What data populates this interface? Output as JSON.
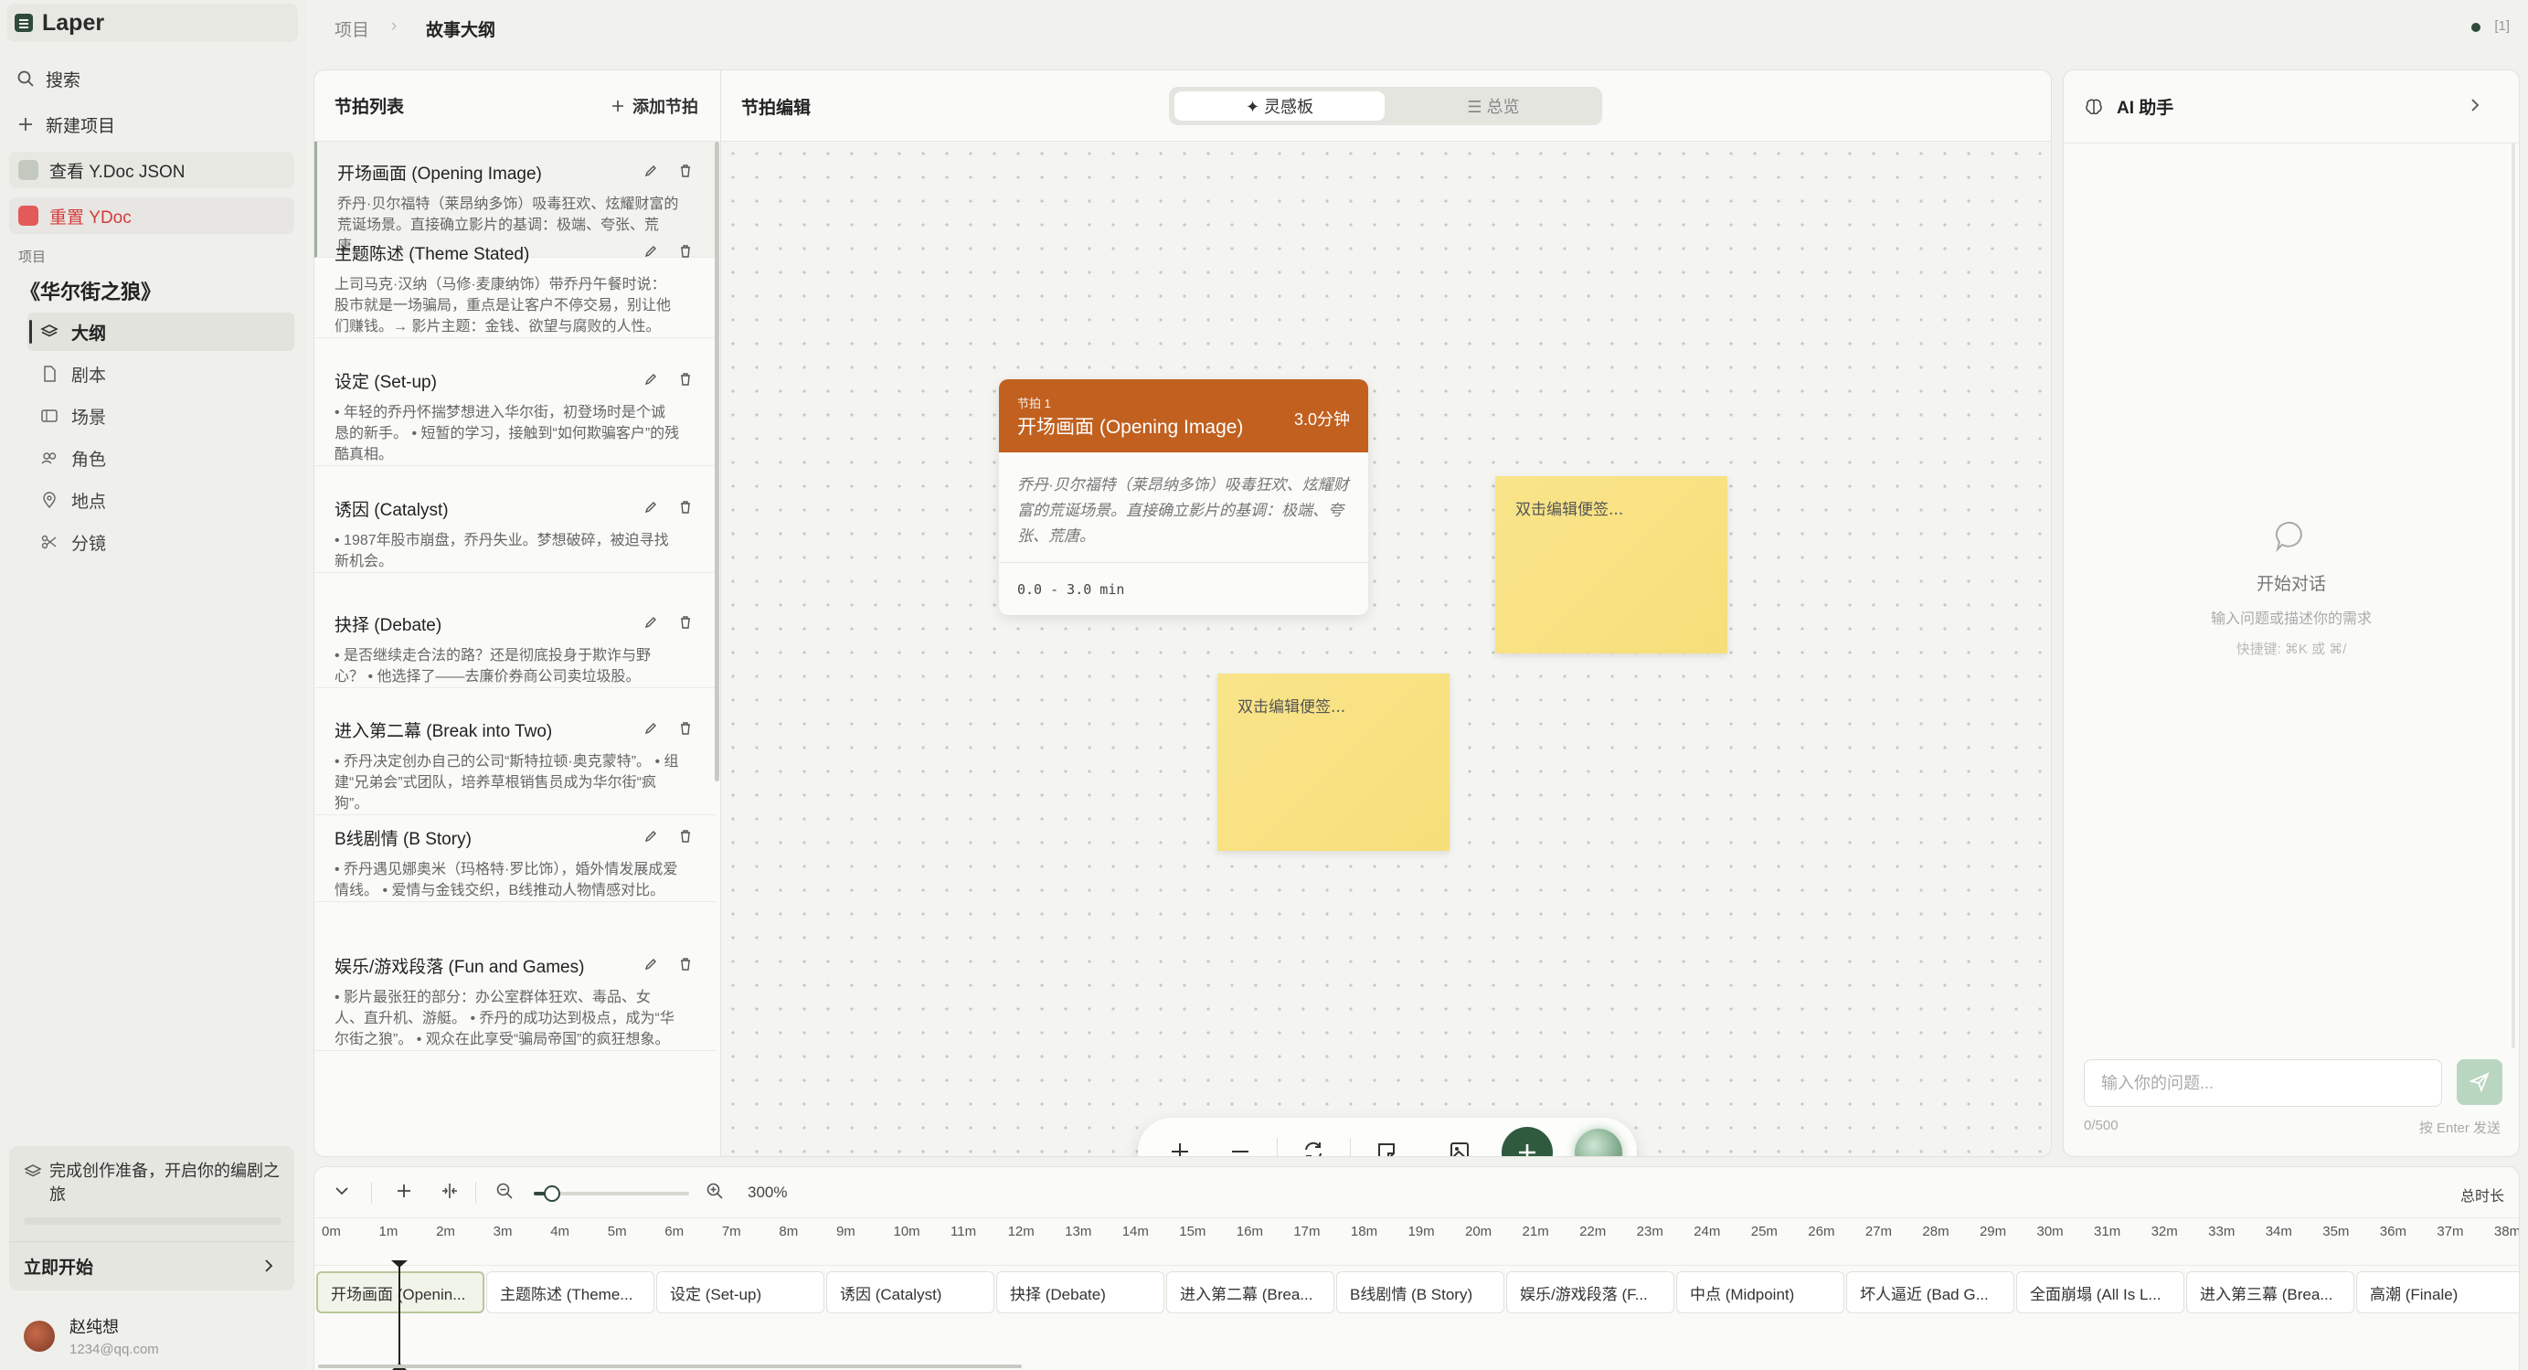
{
  "app": {
    "name": "Laper"
  },
  "sidebar": {
    "search": "搜索",
    "new_project": "新建项目",
    "view_ydoc": "查看 Y.Doc JSON",
    "reset_ydoc": "重置 YDoc",
    "section_label": "项目",
    "project_title": "《华尔街之狼》",
    "nav": [
      "大纲",
      "剧本",
      "场景",
      "角色",
      "地点",
      "分镜"
    ],
    "promo_text": "完成创作准备，开启你的编剧之旅",
    "promo_button": "立即开始",
    "user_name": "赵纯想",
    "user_email": "1234@qq.com"
  },
  "header": {
    "breadcrumb": [
      "项目",
      "故事大纲"
    ],
    "status": "[1]"
  },
  "beat_list": {
    "title": "节拍列表",
    "add_label": "添加节拍",
    "items": [
      {
        "title": "开场画面 (Opening Image)",
        "desc": "乔丹·贝尔福特（莱昂纳多饰）吸毒狂欢、炫耀财富的荒诞场景。直接确立影片的基调：极端、夸张、荒唐。"
      },
      {
        "title": "主题陈述 (Theme Stated)",
        "desc": "上司马克·汉纳（马修·麦康纳饰）带乔丹午餐时说：股市就是一场骗局，重点是让客户不停交易，别让他们赚钱。→ 影片主题：金钱、欲望与腐败的人性。"
      },
      {
        "title": "设定 (Set-up)",
        "desc": "• 年轻的乔丹怀揣梦想进入华尔街，初登场时是个诚恳的新手。 • 短暂的学习，接触到“如何欺骗客户”的残酷真相。"
      },
      {
        "title": "诱因 (Catalyst)",
        "desc": "• 1987年股市崩盘，乔丹失业。梦想破碎，被迫寻找新机会。"
      },
      {
        "title": "抉择 (Debate)",
        "desc": "• 是否继续走合法的路？还是彻底投身于欺诈与野心？ • 他选择了——去廉价券商公司卖垃圾股。"
      },
      {
        "title": "进入第二幕 (Break into Two)",
        "desc": "• 乔丹决定创办自己的公司“斯特拉顿·奥克蒙特”。 • 组建“兄弟会”式团队，培养草根销售员成为华尔街“疯狗”。"
      },
      {
        "title": "B线剧情 (B Story)",
        "desc": "• 乔丹遇见娜奥米（玛格特·罗比饰），婚外情发展成爱情线。 • 爱情与金钱交织，B线推动人物情感对比。"
      },
      {
        "title": "娱乐/游戏段落 (Fun and Games)",
        "desc": "• 影片最张狂的部分：办公室群体狂欢、毒品、女人、直升机、游艇。 • 乔丹的成功达到极点，成为“华尔街之狼”。 • 观众在此享受“骗局帝国”的疯狂想象。"
      }
    ]
  },
  "editor": {
    "title": "节拍编辑",
    "seg_inspiration": "✦ 灵感板",
    "seg_overview": "☰ 总览",
    "card": {
      "label": "节拍 1",
      "title": "开场画面 (Opening Image)",
      "duration": "3.0分钟",
      "body": "乔丹·贝尔福特（莱昂纳多饰）吸毒狂欢、炫耀财富的荒诞场景。直接确立影片的基调：极端、夸张、荒唐。",
      "range": "0.0 - 3.0 min",
      "header_color": "#c1601f"
    },
    "stickies": [
      "双击编辑便签...",
      "双击编辑便签..."
    ]
  },
  "ai": {
    "title": "AI 助手",
    "empty_title": "开始对话",
    "empty_sub": "输入问题或描述你的需求",
    "shortcut": "快捷键: ⌘K 或 ⌘/",
    "placeholder": "输入你的问题...",
    "count": "0/500",
    "hint": "按 Enter 发送"
  },
  "timeline": {
    "zoom": "300%",
    "zoom_fraction": 0.12,
    "total_label": "总时长",
    "ticks": [
      "0m",
      "1m",
      "2m",
      "3m",
      "4m",
      "5m",
      "6m",
      "7m",
      "8m",
      "9m",
      "10m",
      "11m",
      "12m",
      "13m",
      "14m",
      "15m",
      "16m",
      "17m",
      "18m",
      "19m",
      "20m",
      "21m",
      "22m",
      "23m",
      "24m",
      "25m",
      "26m",
      "27m",
      "28m",
      "29m",
      "30m",
      "31m",
      "32m",
      "33m",
      "34m",
      "35m",
      "36m",
      "37m",
      "38m"
    ],
    "clips": [
      "开场画面 (Openin...",
      "主题陈述 (Theme...",
      "设定 (Set-up)",
      "诱因 (Catalyst)",
      "抉择 (Debate)",
      "进入第二幕 (Brea...",
      "B线剧情 (B Story)",
      "娱乐/游戏段落 (F...",
      "中点 (Midpoint)",
      "坏人逼近 (Bad G...",
      "全面崩塌 (All Is L...",
      "进入第三幕 (Brea...",
      "高潮 (Finale)"
    ]
  },
  "colors": {
    "brand": "#2f4a3a",
    "accent": "#2f5a3e",
    "sticky": "#f8e284"
  }
}
